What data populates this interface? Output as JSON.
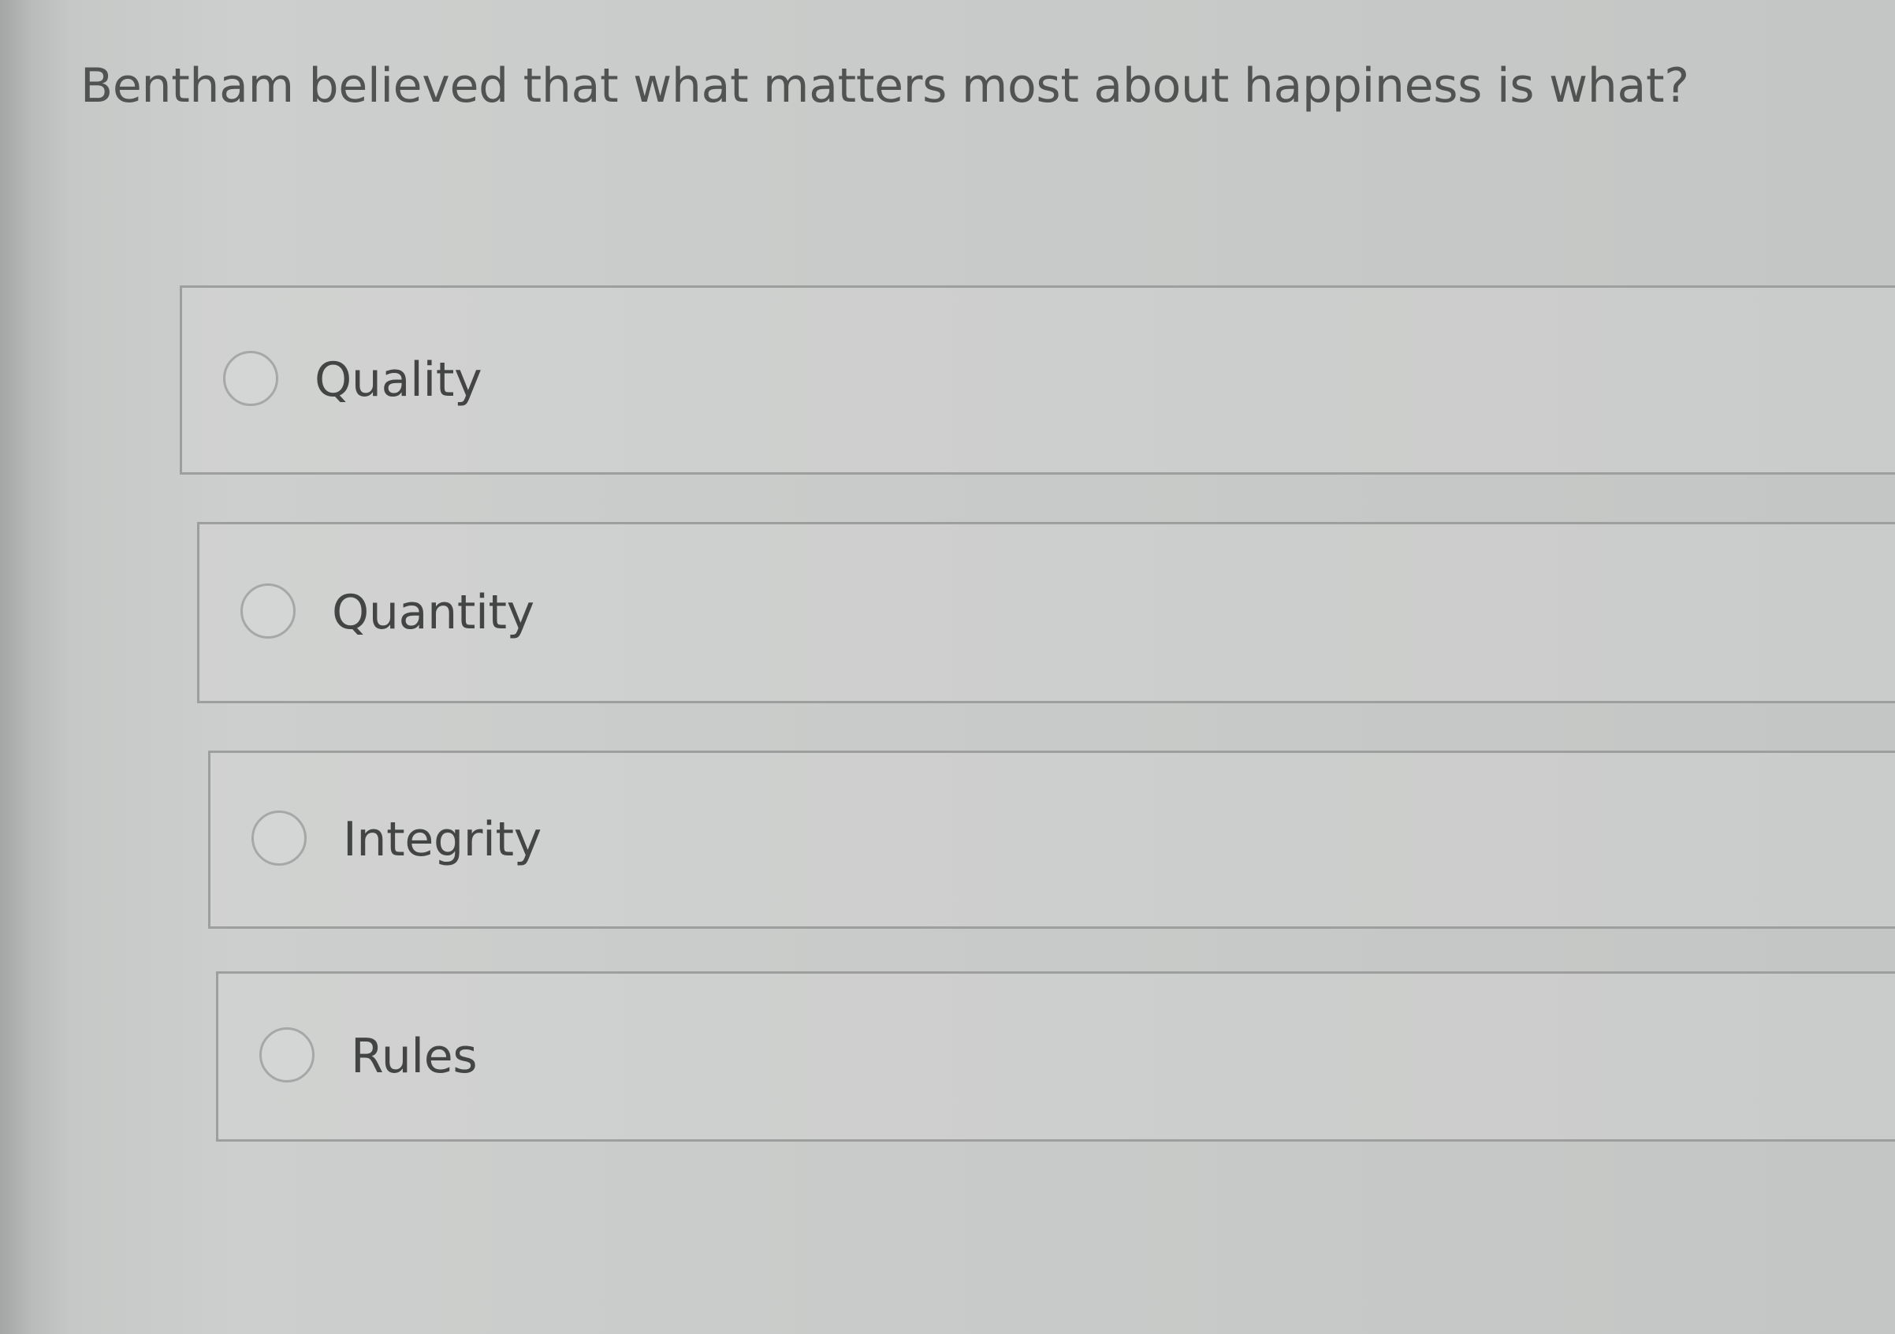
{
  "question": {
    "text": "Bentham believed that what matters most about happiness is what?"
  },
  "options": [
    {
      "label": "Quality"
    },
    {
      "label": "Quantity"
    },
    {
      "label": "Integrity"
    },
    {
      "label": "Rules"
    }
  ],
  "colors": {
    "background": "#cdcfce",
    "border": "#9d9f9e",
    "text": "#434544"
  },
  "icons": {
    "radio": "radio-button-unchecked-icon"
  }
}
